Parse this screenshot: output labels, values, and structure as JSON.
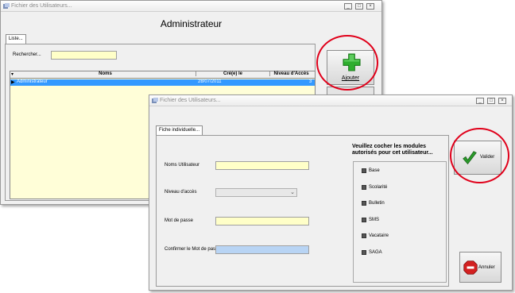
{
  "window1": {
    "title": "Fichier des Utilisateurs...",
    "heading": "Administrateur",
    "tab": "Liste...",
    "search_label": "Rechercher...",
    "search_value": "",
    "columns": [
      "Noms",
      "Cré(e) le",
      "Niveau d'Accès"
    ],
    "rows": [
      {
        "name": "Administrateur",
        "date": "28/07/2011",
        "level": "3"
      }
    ],
    "add_button": "Ajouter"
  },
  "window2": {
    "title": "Fichier des Utilisateurs...",
    "tab": "Fiche individuelle...",
    "fields": {
      "username_label": "Noms Utilisateur",
      "access_label": "Niveau d'accès",
      "password_label": "Mot de passe",
      "confirm_label": "Confirmer le Mot de passe"
    },
    "modules_heading": "Veuillez cocher les modules autorisés pour cet utilisateur...",
    "modules": [
      "Base",
      "Scolarité",
      "Bulletin",
      "SMS",
      "Vacataire",
      "SAGA"
    ],
    "validate_button": "Valider",
    "cancel_button": "Annuler"
  },
  "colors": {
    "selection": "#3399ff",
    "field_bg": "#ffffc8",
    "highlight_circle": "#e0001a",
    "plus_green": "#2eae2e",
    "check_green": "#2a9a2a",
    "cancel_red": "#d32020"
  }
}
